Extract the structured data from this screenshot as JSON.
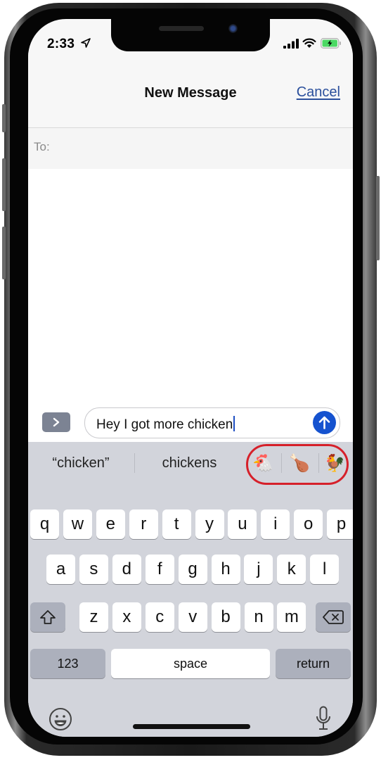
{
  "status_bar": {
    "time": "2:33",
    "icons": [
      "location-arrow-icon",
      "cellular-signal-icon",
      "wifi-icon",
      "battery-charging-icon"
    ]
  },
  "nav": {
    "title": "New Message",
    "cancel_label": "Cancel"
  },
  "recipient": {
    "label": "To:",
    "value": ""
  },
  "compose": {
    "apps_button_icon": "chevron-right-icon",
    "message_text": "Hey I got more chicken",
    "send_button_icon": "arrow-up-icon"
  },
  "predictions": {
    "quoted": "“chicken”",
    "suggestion": "chickens",
    "emoji": [
      {
        "glyph": "🐔",
        "name": "chicken"
      },
      {
        "glyph": "🍗",
        "name": "poultry-leg"
      },
      {
        "glyph": "🐓",
        "name": "rooster"
      }
    ]
  },
  "keyboard": {
    "row1": [
      "q",
      "w",
      "e",
      "r",
      "t",
      "y",
      "u",
      "i",
      "o",
      "p"
    ],
    "row2": [
      "a",
      "s",
      "d",
      "f",
      "g",
      "h",
      "j",
      "k",
      "l"
    ],
    "row3": [
      "z",
      "x",
      "c",
      "v",
      "b",
      "n",
      "m"
    ],
    "numbers_label": "123",
    "space_label": "space",
    "return_label": "return"
  },
  "colors": {
    "accent": "#1552cf",
    "link": "#2a4f9c",
    "highlight": "#d6202a",
    "keyboard_bg": "#d2d4db"
  }
}
